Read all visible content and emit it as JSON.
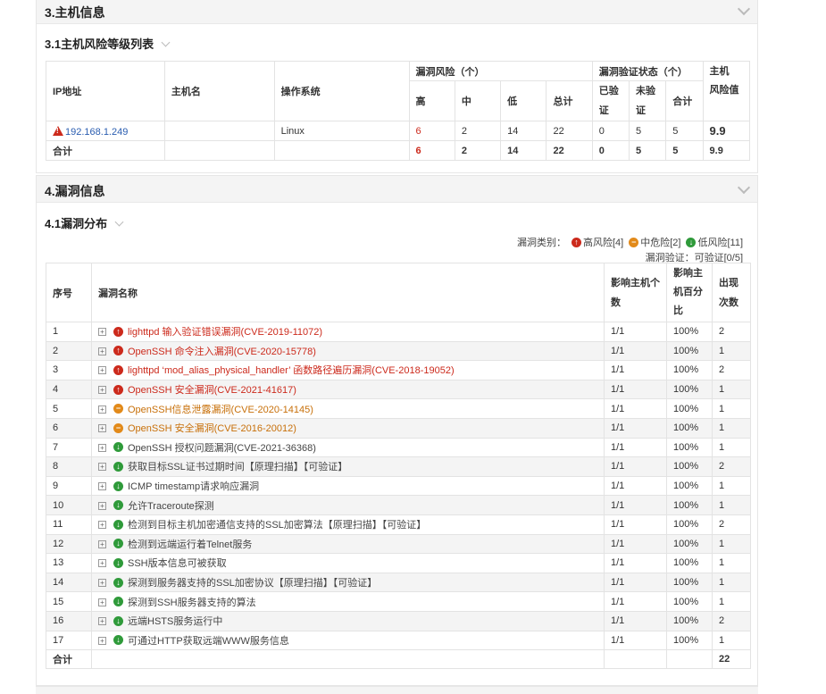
{
  "section3": {
    "title": "3.主机信息",
    "sub_title": "3.1主机风险等级列表",
    "headers": {
      "ip": "IP地址",
      "hostname": "主机名",
      "os": "操作系统",
      "vuln_risk": "漏洞风险（个）",
      "high": "高",
      "mid": "中",
      "low": "低",
      "total": "总计",
      "verify_status": "漏洞验证状态（个）",
      "verified_a": "已验",
      "verified_b": "证",
      "unverified_a": "未验",
      "unverified_b": "证",
      "verify_total": "合计",
      "risk_a": "主机",
      "risk_b": "风险值"
    },
    "row": {
      "ip": "192.168.1.249",
      "hostname": "",
      "os": "Linux",
      "high": "6",
      "mid": "2",
      "low": "14",
      "total": "22",
      "verified": "0",
      "unverified": "5",
      "verify_total": "5",
      "risk": "9.9"
    },
    "total_row": {
      "label": "合计",
      "high": "6",
      "mid": "2",
      "low": "14",
      "total": "22",
      "verified": "0",
      "unverified": "5",
      "verify_total": "5",
      "risk": "9.9"
    }
  },
  "section4": {
    "title": "4.漏洞信息",
    "sub_title": "4.1漏洞分布",
    "legend": {
      "label": "漏洞类别：",
      "high": "高风险[4]",
      "mid": "中危险[2]",
      "low": "低风险[11]",
      "verify": "漏洞验证：可验证[0/5]"
    },
    "headers": {
      "index": "序号",
      "name": "漏洞名称",
      "hosts_a": "影响主机个",
      "hosts_b": "数",
      "pct_a": "影响主",
      "pct_b": "机百分",
      "pct_c": "比",
      "count_a": "出现",
      "count_b": "次数"
    },
    "rows": [
      {
        "idx": "1",
        "level": "high",
        "name": "lighttpd 输入验证错误漏洞(CVE-2019-11072)",
        "hosts": "1/1",
        "pct": "100%",
        "count": "2"
      },
      {
        "idx": "2",
        "level": "high",
        "name": "OpenSSH 命令注入漏洞(CVE-2020-15778)",
        "hosts": "1/1",
        "pct": "100%",
        "count": "1"
      },
      {
        "idx": "3",
        "level": "high",
        "name": "lighttpd ‘mod_alias_physical_handler’ 函数路径遍历漏洞(CVE-2018-19052)",
        "hosts": "1/1",
        "pct": "100%",
        "count": "2"
      },
      {
        "idx": "4",
        "level": "high",
        "name": "OpenSSH 安全漏洞(CVE-2021-41617)",
        "hosts": "1/1",
        "pct": "100%",
        "count": "1"
      },
      {
        "idx": "5",
        "level": "mid",
        "name": "OpenSSH信息泄露漏洞(CVE-2020-14145)",
        "hosts": "1/1",
        "pct": "100%",
        "count": "1"
      },
      {
        "idx": "6",
        "level": "mid",
        "name": "OpenSSH 安全漏洞(CVE-2016-20012)",
        "hosts": "1/1",
        "pct": "100%",
        "count": "1"
      },
      {
        "idx": "7",
        "level": "low",
        "name": "OpenSSH 授权问题漏洞(CVE-2021-36368)",
        "hosts": "1/1",
        "pct": "100%",
        "count": "1"
      },
      {
        "idx": "8",
        "level": "low",
        "name": "获取目标SSL证书过期时间【原理扫描】【可验证】",
        "hosts": "1/1",
        "pct": "100%",
        "count": "2"
      },
      {
        "idx": "9",
        "level": "low",
        "name": "ICMP timestamp请求响应漏洞",
        "hosts": "1/1",
        "pct": "100%",
        "count": "1"
      },
      {
        "idx": "10",
        "level": "low",
        "name": "允许Traceroute探测",
        "hosts": "1/1",
        "pct": "100%",
        "count": "1"
      },
      {
        "idx": "11",
        "level": "low",
        "name": "检测到目标主机加密通信支持的SSL加密算法【原理扫描】【可验证】",
        "hosts": "1/1",
        "pct": "100%",
        "count": "2"
      },
      {
        "idx": "12",
        "level": "low",
        "name": "检测到远端运行着Telnet服务",
        "hosts": "1/1",
        "pct": "100%",
        "count": "1"
      },
      {
        "idx": "13",
        "level": "low",
        "name": "SSH版本信息可被获取",
        "hosts": "1/1",
        "pct": "100%",
        "count": "1"
      },
      {
        "idx": "14",
        "level": "low",
        "name": "探测到服务器支持的SSL加密协议【原理扫描】【可验证】",
        "hosts": "1/1",
        "pct": "100%",
        "count": "1"
      },
      {
        "idx": "15",
        "level": "low",
        "name": "探测到SSH服务器支持的算法",
        "hosts": "1/1",
        "pct": "100%",
        "count": "1"
      },
      {
        "idx": "16",
        "level": "low",
        "name": "远端HSTS服务运行中",
        "hosts": "1/1",
        "pct": "100%",
        "count": "2"
      },
      {
        "idx": "17",
        "level": "low",
        "name": "可通过HTTP获取远端WWW服务信息",
        "hosts": "1/1",
        "pct": "100%",
        "count": "1"
      }
    ],
    "total_label": "合计",
    "total_count": "22"
  }
}
